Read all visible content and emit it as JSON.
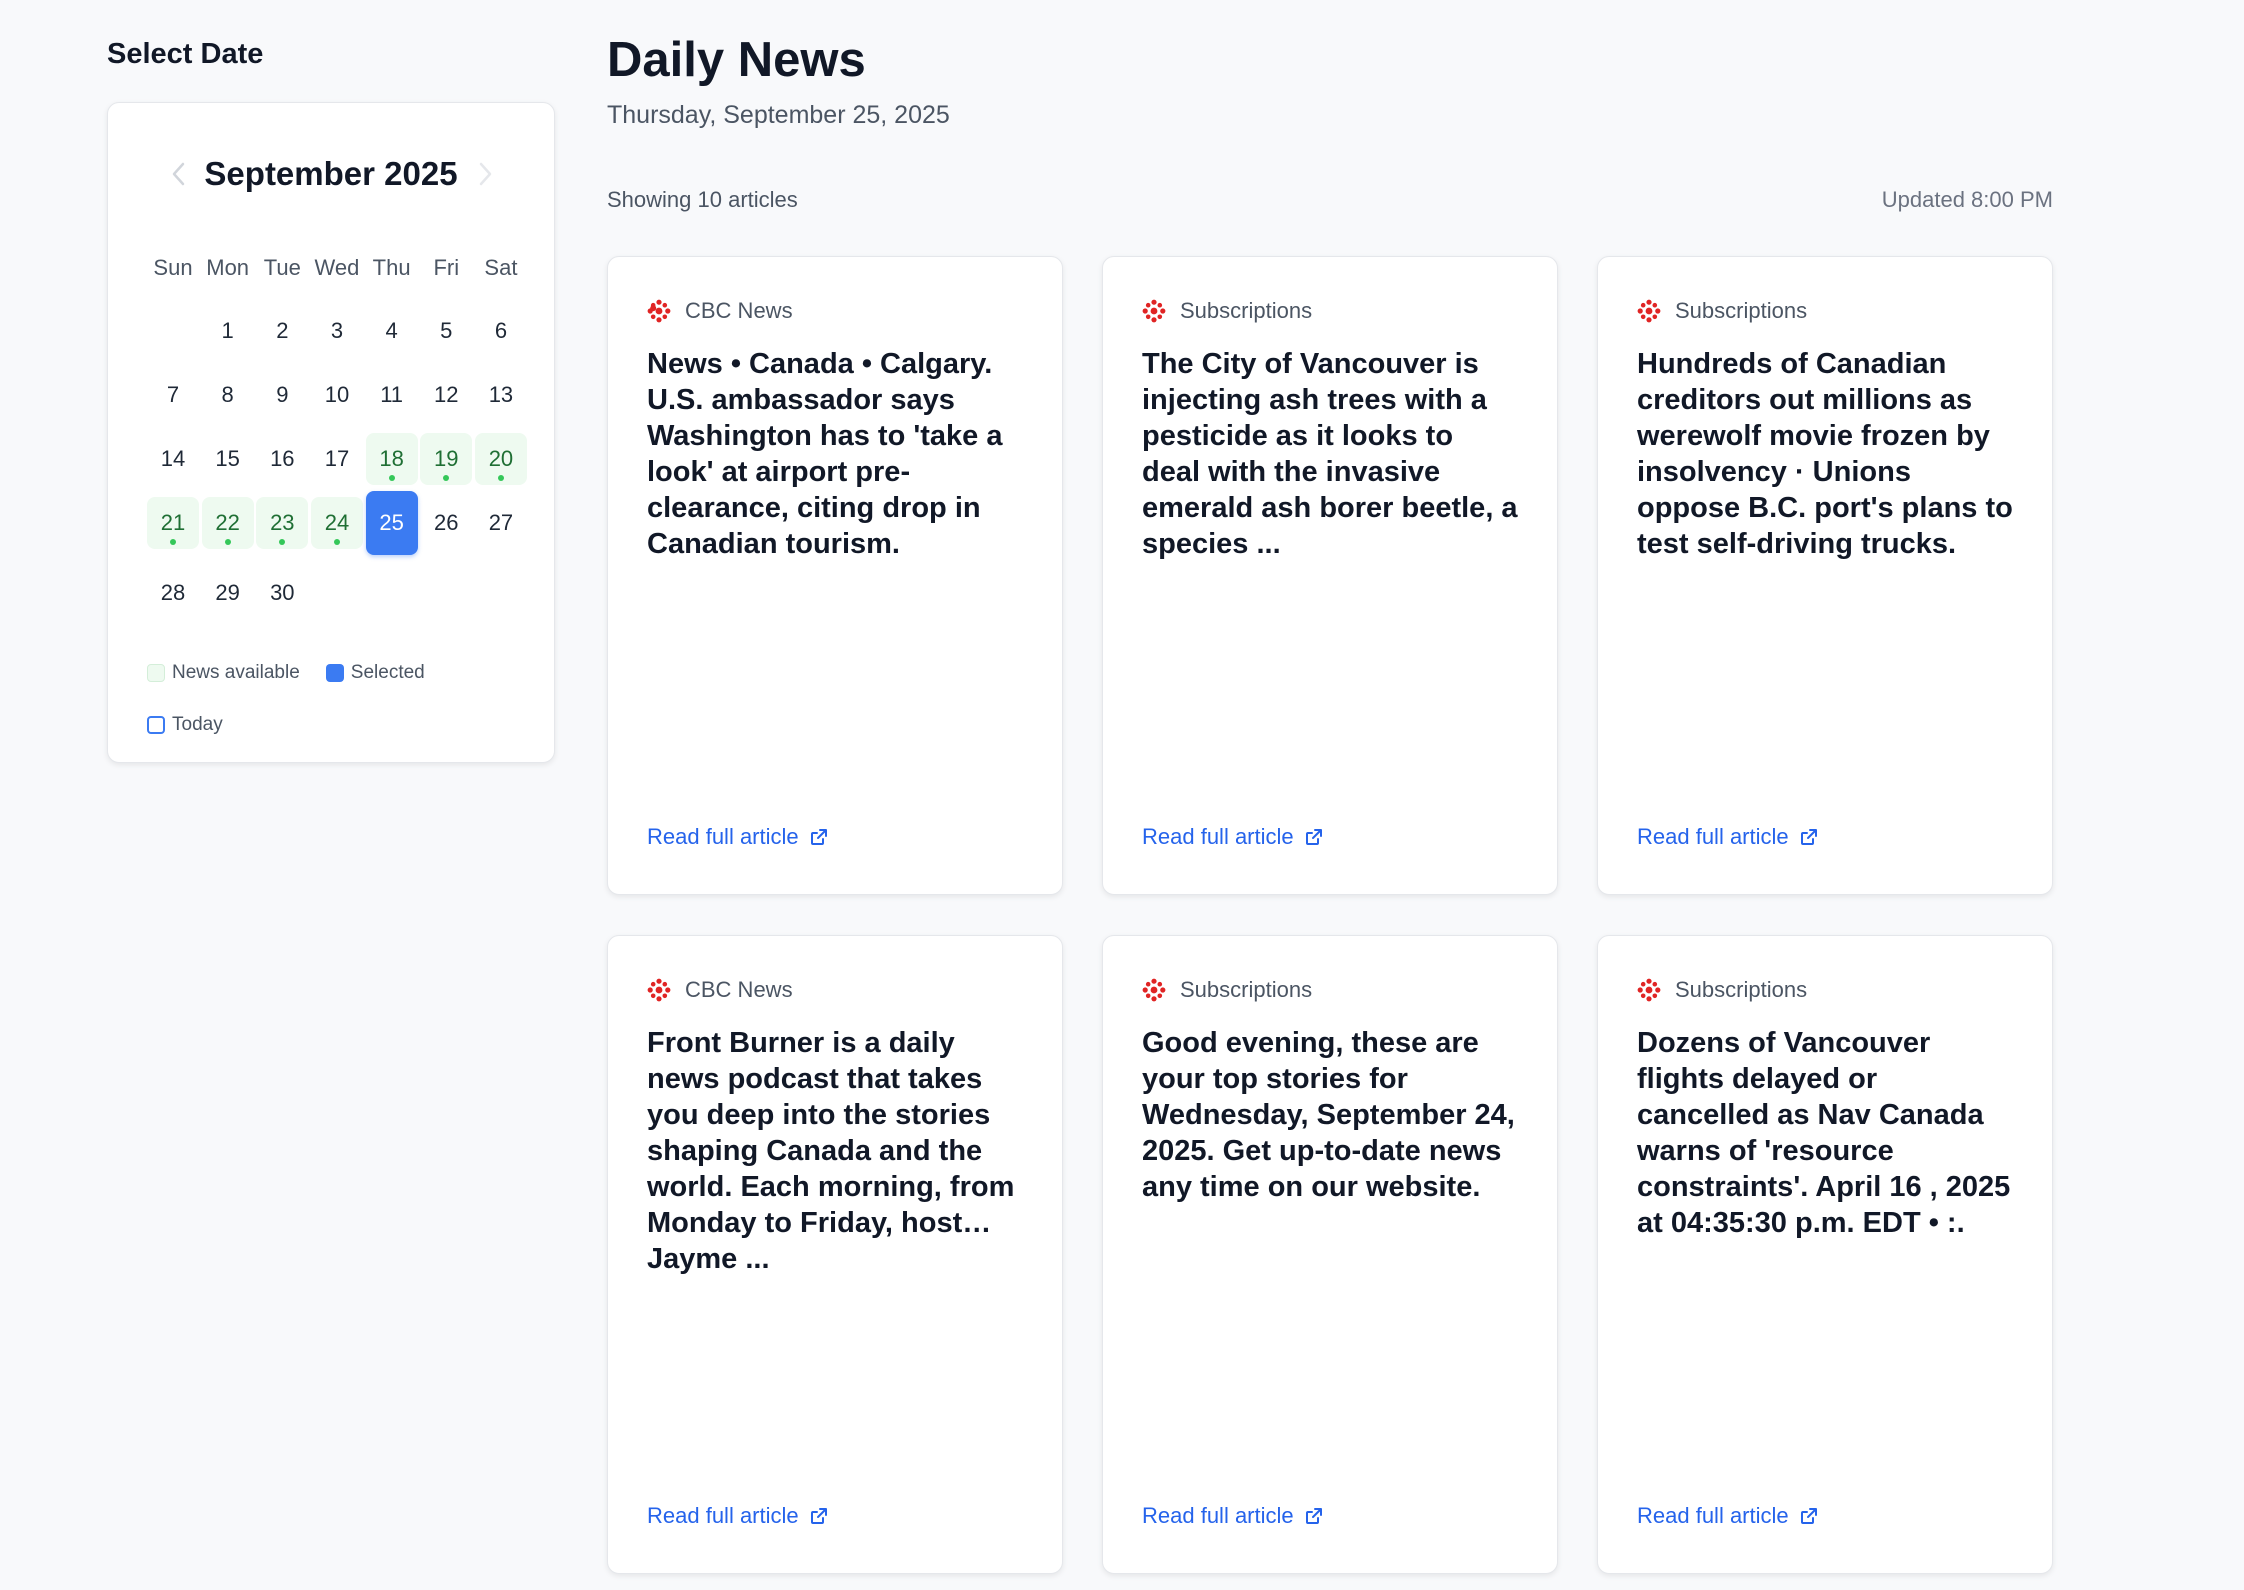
{
  "sidebar": {
    "title": "Select Date",
    "calendar": {
      "month_label": "September 2025",
      "weekdays": [
        "Sun",
        "Mon",
        "Tue",
        "Wed",
        "Thu",
        "Fri",
        "Sat"
      ],
      "days": [
        "1",
        "2",
        "3",
        "4",
        "5",
        "6",
        "7",
        "8",
        "9",
        "10",
        "11",
        "12",
        "13",
        "14",
        "15",
        "16",
        "17",
        "18",
        "19",
        "20",
        "21",
        "22",
        "23",
        "24",
        "25",
        "26",
        "27",
        "28",
        "29",
        "30"
      ],
      "available_days": [
        18,
        19,
        20,
        21,
        22,
        23,
        24
      ],
      "selected_day": 25,
      "first_weekday_index": 1
    },
    "legend": {
      "available": "News available",
      "selected": "Selected",
      "today": "Today"
    }
  },
  "main": {
    "title": "Daily News",
    "date": "Thursday, September 25, 2025",
    "showing": "Showing 10 articles",
    "updated": "Updated 8:00 PM",
    "read_more_label": "Read full article",
    "articles": [
      {
        "source": "CBC News",
        "title": "News • Canada • Calgary. U.S. ambassador says Washington has to 'take a look' at airport pre-clearance, citing drop in Canadian tourism."
      },
      {
        "source": "Subscriptions",
        "title": "The City of Vancouver is injecting ash trees with a pesticide as it looks to deal with the invasive emerald ash borer beetle, a species ..."
      },
      {
        "source": "Subscriptions",
        "title": "Hundreds of Canadian creditors out millions as werewolf movie frozen by insolvency · Unions oppose B.C. port's plans to test self-driving trucks."
      },
      {
        "source": "CBC News",
        "title": "Front Burner is a daily news podcast that takes you deep into the stories shaping Canada and the world. Each morning, from Monday to Friday, host… Jayme ..."
      },
      {
        "source": "Subscriptions",
        "title": "Good evening, these are your top stories for Wednesday, September 24, 2025. Get up-to-date news any time on our website."
      },
      {
        "source": "Subscriptions",
        "title": "Dozens of Vancouver flights delayed or cancelled as Nav Canada warns of 'resource constraints'. April 16 , 2025 at 04:35:30 p.m. EDT • :."
      }
    ]
  },
  "colors": {
    "accent": "#3b7bf2",
    "link": "#2563eb",
    "available_bg": "#eefaf0",
    "available_dot": "#34c759",
    "brand_icon": "#e02424"
  },
  "icons": {
    "prev": "chevron-left-icon",
    "next": "chevron-right-icon",
    "source": "cbc-gem-icon",
    "external": "external-link-icon"
  }
}
